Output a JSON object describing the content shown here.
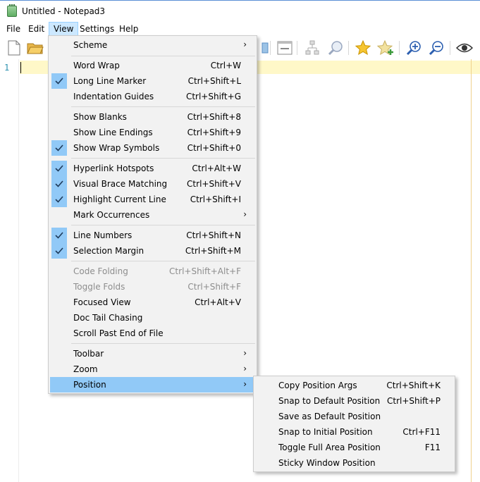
{
  "window": {
    "title": "Untitled - Notepad3"
  },
  "menubar": {
    "file": "File",
    "edit": "Edit",
    "view": "View",
    "settings": "Settings",
    "help": "Help"
  },
  "editor": {
    "line_number": "1"
  },
  "view_menu": {
    "scheme": "Scheme",
    "word_wrap": {
      "label": "Word Wrap",
      "shortcut": "Ctrl+W"
    },
    "long_line_marker": {
      "label": "Long Line Marker",
      "shortcut": "Ctrl+Shift+L",
      "checked": true
    },
    "indentation_guides": {
      "label": "Indentation Guides",
      "shortcut": "Ctrl+Shift+G"
    },
    "show_blanks": {
      "label": "Show Blanks",
      "shortcut": "Ctrl+Shift+8"
    },
    "show_line_endings": {
      "label": "Show Line Endings",
      "shortcut": "Ctrl+Shift+9"
    },
    "show_wrap_symbols": {
      "label": "Show Wrap Symbols",
      "shortcut": "Ctrl+Shift+0",
      "checked": true
    },
    "hyperlink_hotspots": {
      "label": "Hyperlink Hotspots",
      "shortcut": "Ctrl+Alt+W",
      "checked": true
    },
    "visual_brace_matching": {
      "label": "Visual Brace Matching",
      "shortcut": "Ctrl+Shift+V",
      "checked": true
    },
    "highlight_current_line": {
      "label": "Highlight Current Line",
      "shortcut": "Ctrl+Shift+I",
      "checked": true
    },
    "mark_occurrences": "Mark Occurrences",
    "line_numbers": {
      "label": "Line Numbers",
      "shortcut": "Ctrl+Shift+N",
      "checked": true
    },
    "selection_margin": {
      "label": "Selection Margin",
      "shortcut": "Ctrl+Shift+M",
      "checked": true
    },
    "code_folding": {
      "label": "Code Folding",
      "shortcut": "Ctrl+Shift+Alt+F",
      "disabled": true
    },
    "toggle_folds": {
      "label": "Toggle Folds",
      "shortcut": "Ctrl+Shift+F",
      "disabled": true
    },
    "focused_view": {
      "label": "Focused View",
      "shortcut": "Ctrl+Alt+V"
    },
    "doc_tail_chasing": "Doc Tail Chasing",
    "scroll_past_end": "Scroll Past End of File",
    "toolbar": "Toolbar",
    "zoom": "Zoom",
    "position": "Position"
  },
  "position_menu": {
    "copy_position_args": {
      "label": "Copy Position Args",
      "shortcut": "Ctrl+Shift+K"
    },
    "snap_to_default": {
      "label": "Snap to Default Position",
      "shortcut": "Ctrl+Shift+P"
    },
    "save_as_default": {
      "label": "Save as Default Position",
      "shortcut": ""
    },
    "snap_to_initial": {
      "label": "Snap to Initial Position",
      "shortcut": "Ctrl+F11"
    },
    "toggle_full_area": {
      "label": "Toggle Full Area Position",
      "shortcut": "F11"
    },
    "sticky_window": {
      "label": "Sticky Window Position",
      "shortcut": ""
    }
  },
  "colors": {
    "menu_highlight": "#91c9f7",
    "menubar_active": "#cce8ff",
    "current_line": "#fff8c8",
    "line_number": "#2b91af",
    "long_line_marker": "#f0d28c"
  },
  "toolbar_icons": [
    "new-file-icon",
    "open-folder-icon",
    "copy-icon",
    "window-icon",
    "tree-icon",
    "find-icon",
    "star-icon",
    "add-favorite-icon",
    "zoom-in-icon",
    "zoom-out-icon",
    "eye-icon"
  ]
}
